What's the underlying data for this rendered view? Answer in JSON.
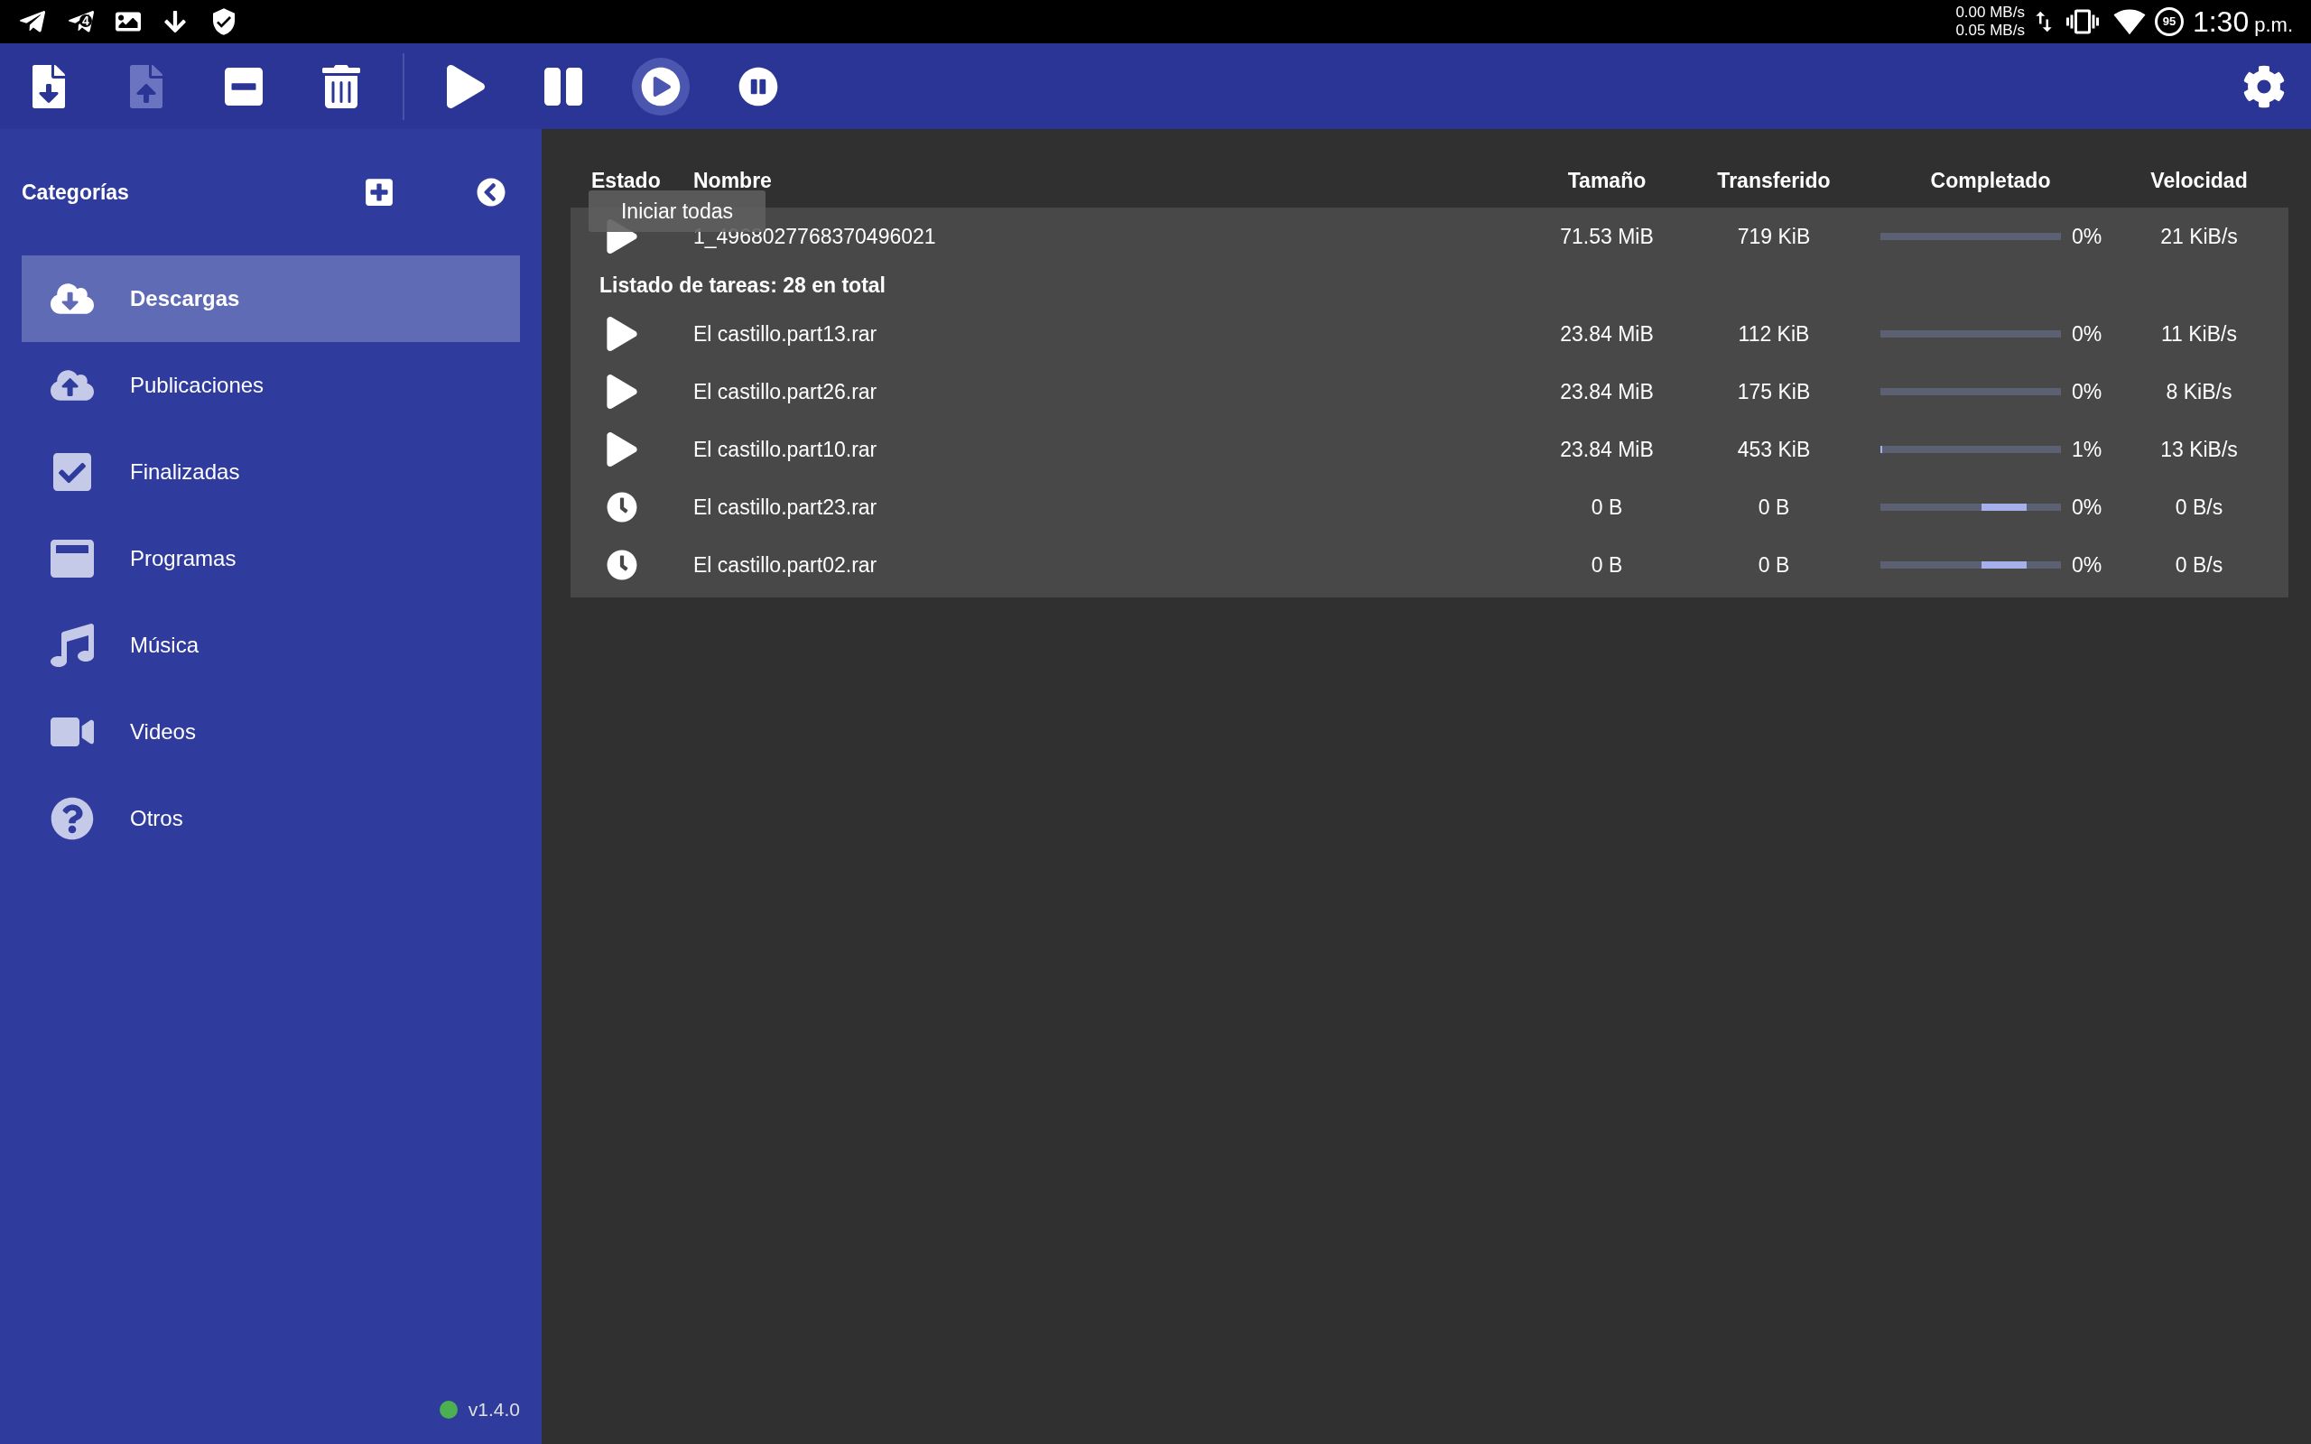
{
  "status_bar": {
    "notification_badge": "4",
    "speed_up": "0.00 MB/s",
    "speed_down": "0.05 MB/s",
    "battery": "95",
    "time": "1:30",
    "time_suffix": "p.m."
  },
  "toolbar": [
    {
      "disabled": false,
      "hovered": false
    },
    {
      "disabled": true,
      "hovered": false
    },
    {
      "disabled": false,
      "hovered": false
    },
    {
      "disabled": false,
      "hovered": false
    },
    {
      "disabled": false,
      "hovered": false
    },
    {
      "disabled": false,
      "hovered": false
    },
    {
      "disabled": false,
      "hovered": true
    },
    {
      "disabled": false,
      "hovered": false
    }
  ],
  "tooltip": "Iniciar todas",
  "sidebar": {
    "title": "Categorías",
    "items": [
      {
        "label": "Descargas",
        "selected": true
      },
      {
        "label": "Publicaciones",
        "selected": false
      },
      {
        "label": "Finalizadas",
        "selected": false
      },
      {
        "label": "Programas",
        "selected": false
      },
      {
        "label": "Música",
        "selected": false
      },
      {
        "label": "Videos",
        "selected": false
      },
      {
        "label": "Otros",
        "selected": false
      }
    ],
    "version": {
      "label": "v1.4.0",
      "color": "#4caf50"
    }
  },
  "table": {
    "columns": [
      "Estado",
      "Nombre",
      "Tamaño",
      "Transferido",
      "Completado",
      "Velocidad"
    ],
    "rows": [
      {
        "kind": "task",
        "paused": true,
        "name": "1_4968027768370496021",
        "size": "71.53 MiB",
        "transferred": "719 KiB",
        "level": 0,
        "indeterminate": false,
        "percent": "0%",
        "speed": "21 KiB/s"
      },
      {
        "kind": "group",
        "label": "Listado de tareas: 28 en total"
      },
      {
        "kind": "task",
        "paused": true,
        "name": "El castillo.part13.rar",
        "size": "23.84 MiB",
        "transferred": "112 KiB",
        "level": 0,
        "indeterminate": false,
        "percent": "0%",
        "speed": "11 KiB/s"
      },
      {
        "kind": "task",
        "paused": true,
        "name": "El castillo.part26.rar",
        "size": "23.84 MiB",
        "transferred": "175 KiB",
        "level": 0,
        "indeterminate": false,
        "percent": "0%",
        "speed": "8 KiB/s"
      },
      {
        "kind": "task",
        "paused": true,
        "name": "El castillo.part10.rar",
        "size": "23.84 MiB",
        "transferred": "453 KiB",
        "level": 0.01,
        "indeterminate": false,
        "percent": "1%",
        "speed": "13 KiB/s"
      },
      {
        "kind": "task",
        "paused": false,
        "name": "El castillo.part23.rar",
        "size": "0 B",
        "transferred": "0 B",
        "indeterminate": true,
        "percent": "0%",
        "speed": "0 B/s"
      },
      {
        "kind": "task",
        "paused": false,
        "name": "El castillo.part02.rar",
        "size": "0 B",
        "transferred": "0 B",
        "indeterminate": true,
        "percent": "0%",
        "speed": "0 B/s"
      }
    ]
  }
}
